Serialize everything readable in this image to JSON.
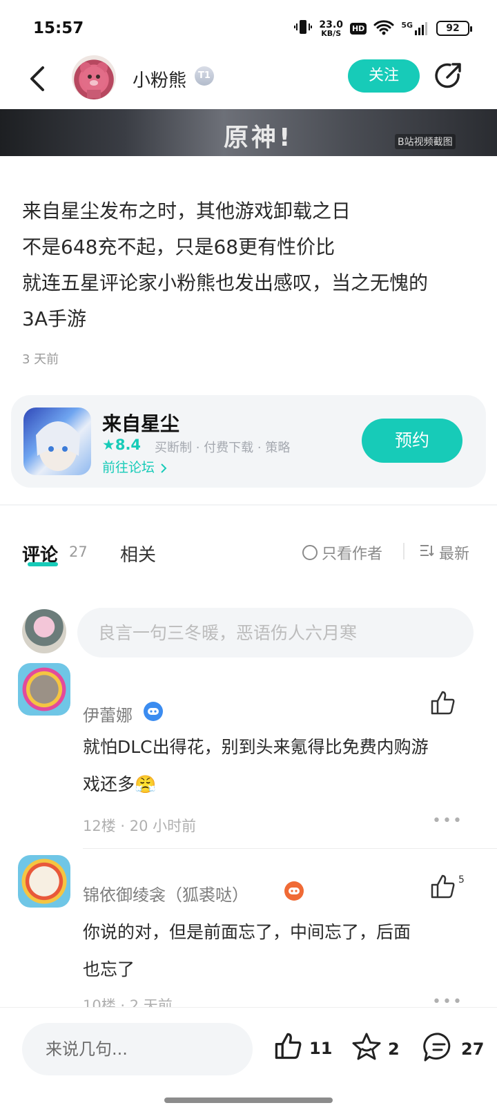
{
  "status_bar": {
    "time": "15:57",
    "net_speed_value": "23.0",
    "net_speed_unit": "KB/S",
    "hd_label": "HD",
    "signal_label": "5G",
    "battery": "92"
  },
  "header": {
    "user_name": "小粉熊",
    "level_badge": "T1",
    "follow_label": "关注"
  },
  "banner": {
    "text": "原神!",
    "watermark": "B站视频截图"
  },
  "post": {
    "lines": [
      "来自星尘发布之时，其他游戏卸载之日",
      "不是648充不起，只是68更有性价比",
      "就连五星评论家小粉熊也发出感叹，当之无愧的",
      "3A手游"
    ],
    "time": "3 天前"
  },
  "game_card": {
    "title": "来自星尘",
    "rating": "8.4",
    "tags": "买断制 · 付费下载 · 策略",
    "forum_link": "前往论坛",
    "reserve_label": "预约"
  },
  "tabs": {
    "comments_label": "评论",
    "comments_count": "27",
    "related_label": "相关",
    "only_author_label": "只看作者",
    "sort_label": "最新"
  },
  "comment_box": {
    "placeholder": "良言一句三冬暖，恶语伤人六月寒"
  },
  "comments": [
    {
      "user": "伊蕾娜",
      "text_line1": "就怕DLC出得花，别到头来氪得比免费内购游",
      "text_line2": "戏还多",
      "emoji": "😤",
      "meta": "12楼 · 20 小时前",
      "likes": ""
    },
    {
      "user": "锦依御绫衾（狐裘哒）",
      "text_line1": "你说的对，但是前面忘了，中间忘了，后面",
      "text_line2": "也忘了",
      "meta": "10楼 · 2 天前",
      "likes": "5"
    }
  ],
  "bottom_bar": {
    "input_placeholder": "来说几句...",
    "likes": "11",
    "favorites": "2",
    "comments": "27"
  },
  "colors": {
    "accent": "#17cbb8",
    "text_primary": "#2a2a2a",
    "text_secondary": "#9a9a9a",
    "card_bg": "#f3f5f7"
  }
}
